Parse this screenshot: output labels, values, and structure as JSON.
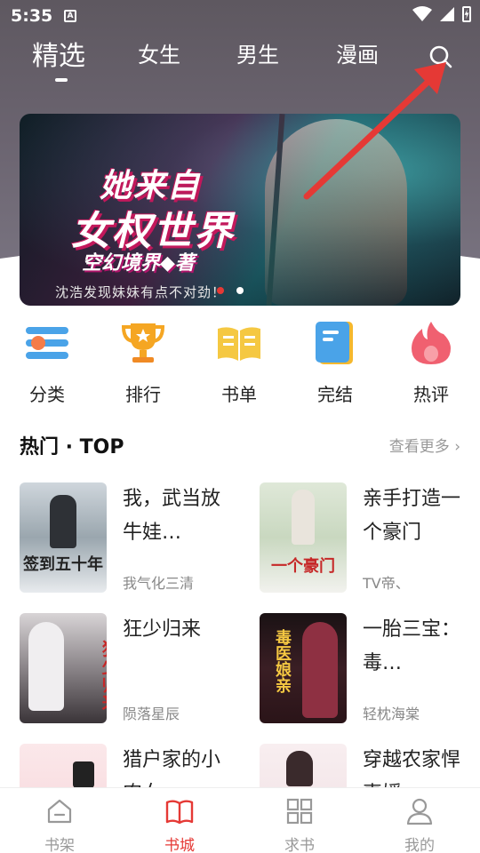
{
  "status_bar": {
    "time": "5:35",
    "notification": "A"
  },
  "nav": {
    "tabs": [
      {
        "label": "精选",
        "active": true
      },
      {
        "label": "女生",
        "active": false
      },
      {
        "label": "男生",
        "active": false
      },
      {
        "label": "漫画",
        "active": false
      }
    ],
    "search_icon": "search-icon"
  },
  "banner": {
    "title_line1": "她来自",
    "title_line2": "女权世界",
    "author": "空幻境界◆著",
    "caption": "沈浩发现妹妹有点不对劲！",
    "pages": 2,
    "current_page": 1
  },
  "categories": [
    {
      "label": "分类",
      "icon": "list-icon",
      "color": "#4aa3e8"
    },
    {
      "label": "排行",
      "icon": "trophy-icon",
      "color": "#f5a623"
    },
    {
      "label": "书单",
      "icon": "open-book-icon",
      "color": "#f5c842"
    },
    {
      "label": "完结",
      "icon": "completed-book-icon",
      "color": "#f5b82e"
    },
    {
      "label": "热评",
      "icon": "flame-icon",
      "color": "#f06070"
    }
  ],
  "hot_section": {
    "title": "热门 · TOP",
    "more": "查看更多"
  },
  "books": [
    {
      "title": "我，武当放牛娃…",
      "author": "我气化三清",
      "cover_text": "签到五十年"
    },
    {
      "title": "亲手打造一个豪门",
      "author": "TV帝、",
      "cover_text": "一个豪门"
    },
    {
      "title": "狂少归来",
      "author": "陨落星辰",
      "cover_text": "狂少归来"
    },
    {
      "title": "一胎三宝：毒…",
      "author": "轻枕海棠",
      "cover_text": "毒医娘亲"
    },
    {
      "title": "猎户家的小农女",
      "author": "",
      "cover_text": ""
    },
    {
      "title": "穿越农家悍妻媛",
      "author": "",
      "cover_text": ""
    }
  ],
  "bottom_nav": [
    {
      "label": "书架",
      "icon": "bookshelf-icon",
      "active": false
    },
    {
      "label": "书城",
      "icon": "bookstore-icon",
      "active": true
    },
    {
      "label": "求书",
      "icon": "grid-icon",
      "active": false
    },
    {
      "label": "我的",
      "icon": "profile-icon",
      "active": false
    }
  ],
  "colors": {
    "accent": "#e53935",
    "header": "#6b6470"
  }
}
